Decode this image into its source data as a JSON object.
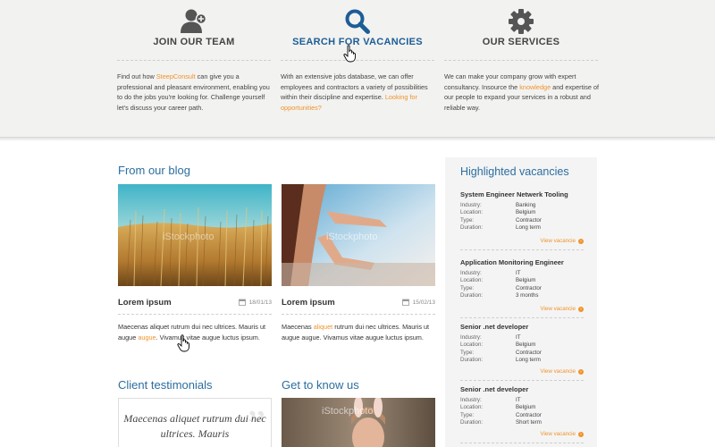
{
  "features": [
    {
      "title": "JOIN OUR TEAM",
      "icon": "add-user-icon",
      "text_parts": [
        "Find out how ",
        "SteepConsult",
        " can give you a professional and pleasant environment, enabling you to do the jobs you're looking for. Challenge yourself let's discuss your career path."
      ]
    },
    {
      "title": "SEARCH FOR VACANCIES",
      "icon": "search-icon",
      "text_parts": [
        "With an extensive jobs database, we can offer employees and contractors a variety of possibilities within their discipline and expertise. ",
        "Looking for opportunities?"
      ]
    },
    {
      "title": "OUR SERVICES",
      "icon": "gear-icon",
      "text_parts": [
        "We can make your company grow with expert consultancy. Insource the ",
        "knowledge",
        " and expertise of our people to expand your services in a robust and reliable way."
      ]
    }
  ],
  "blog": {
    "title": "From our blog",
    "watermark": "iStockphoto",
    "posts": [
      {
        "title": "Lorem ipsum",
        "date": "18/01/13",
        "text_parts": [
          "Maecenas aliquet rutrum dui nec ultrices. Mauris ut augue ",
          "augue",
          ". Vivamus vitae augue luctus ipsum."
        ]
      },
      {
        "title": "Lorem ipsum",
        "date": "15/02/13",
        "text_parts": [
          "Maecenas ",
          "aliquet",
          " rutrum dui nec ultrices. Mauris ut augue augue. Vivamus vitae augue luctus ipsum."
        ]
      }
    ]
  },
  "vacancies": {
    "title": "Highlighted vacancies",
    "view_label": "View vacancie",
    "labels": {
      "industry": "Industry:",
      "location": "Location:",
      "type": "Type:",
      "duration": "Duration:"
    },
    "items": [
      {
        "title": "System Engineer Netwerk Tooling",
        "industry": "Banking",
        "location": "Belgium",
        "type": "Contractor",
        "duration": "Long term"
      },
      {
        "title": "Application Monitoring Engineer",
        "industry": "IT",
        "location": "Belgium",
        "type": "Contractor",
        "duration": "3 months"
      },
      {
        "title": "Senior .net developer",
        "industry": "IT",
        "location": "Belgium",
        "type": "Contractor",
        "duration": "Long term"
      },
      {
        "title": "Senior .net developer",
        "industry": "IT",
        "location": "Belgium",
        "type": "Contractor",
        "duration": "Short term"
      }
    ]
  },
  "testimonials": {
    "title": "Client testimonials",
    "quote": "Maecenas aliquet rutrum dui nec ultrices. Mauris"
  },
  "know_us": {
    "title": "Get to know us",
    "watermark": "iStockphoto"
  },
  "colors": {
    "accent": "#f0932b",
    "link_blue": "#2b6ea0",
    "top_band": "#f2f2f0",
    "sidebar": "#f4f4f4"
  }
}
